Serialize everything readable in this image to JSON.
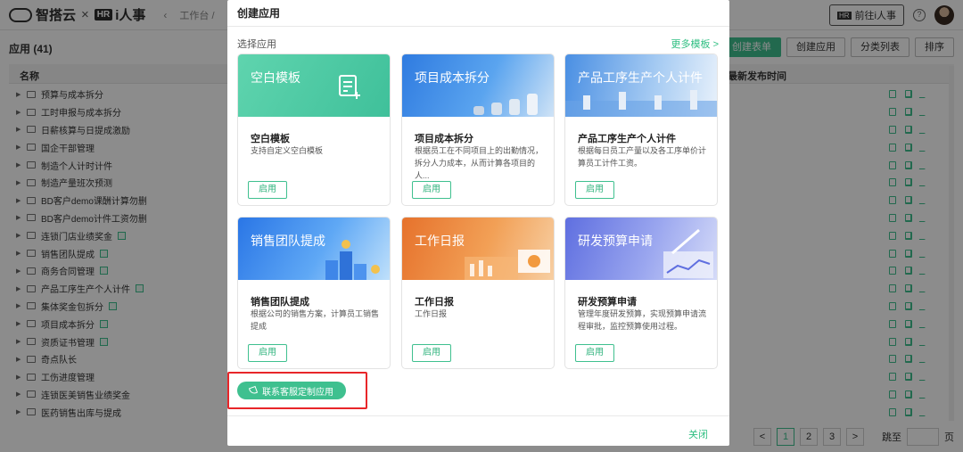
{
  "topbar": {
    "brand_name": "智搭云",
    "separator": "×",
    "hr_logo": "HR",
    "hr_product": "i人事",
    "back_icon": "‹",
    "breadcrumb": "工作台 /",
    "goto_hr_label": "前往i人事",
    "help_icon": "?"
  },
  "page": {
    "title": "应用 (41)",
    "buttons": {
      "create_form": "创建表单",
      "create_app": "创建应用",
      "category_list": "分类列表",
      "sort": "排序"
    },
    "columns": {
      "name": "名称",
      "latest_publish": "最新发布时间"
    },
    "rows": [
      {
        "name": "预算与成本拆分",
        "tag": false
      },
      {
        "name": "工时申报与成本拆分",
        "tag": false
      },
      {
        "name": "日薪核算与日提成激励",
        "tag": false
      },
      {
        "name": "国企干部管理",
        "tag": false
      },
      {
        "name": "制造个人计时计件",
        "tag": false
      },
      {
        "name": "制造产量班次预测",
        "tag": false
      },
      {
        "name": "BD客户demo课酬计算勿删",
        "tag": false
      },
      {
        "name": "BD客户demo计件工资勿删",
        "tag": false
      },
      {
        "name": "连锁门店业绩奖金",
        "tag": true
      },
      {
        "name": "销售团队提成",
        "tag": true
      },
      {
        "name": "商务合同管理",
        "tag": true
      },
      {
        "name": "产品工序生产个人计件",
        "tag": true
      },
      {
        "name": "集体奖金包拆分",
        "tag": true
      },
      {
        "name": "项目成本拆分",
        "tag": true
      },
      {
        "name": "资质证书管理",
        "tag": true
      },
      {
        "name": "奇点队长",
        "tag": false
      },
      {
        "name": "工伤进度管理",
        "tag": false
      },
      {
        "name": "连锁医美销售业绩奖金",
        "tag": false
      },
      {
        "name": "医药销售出库与提成",
        "tag": false
      }
    ],
    "pager": {
      "prev": "<",
      "pages": [
        "1",
        "2",
        "3"
      ],
      "current": "1",
      "next": ">",
      "jump_label": "跳至",
      "page_suffix": "页"
    }
  },
  "modal": {
    "title": "创建应用",
    "section_label": "选择应用",
    "more_templates": "更多模板 >",
    "use_label": "启用",
    "cards": [
      {
        "banner": "空白模板",
        "name": "空白模板",
        "desc": "支持自定义空白模板"
      },
      {
        "banner": "项目成本拆分",
        "name": "项目成本拆分",
        "desc": "根据员工在不同项目上的出勤情况，拆分人力成本，从而计算各项目的人..."
      },
      {
        "banner": "产品工序生产个人计件",
        "name": "产品工序生产个人计件",
        "desc": "根据每日员工产量以及各工序单价计算员工计件工资。"
      },
      {
        "banner": "销售团队提成",
        "name": "销售团队提成",
        "desc": "根据公司的销售方案，计算员工销售提成"
      },
      {
        "banner": "工作日报",
        "name": "工作日报",
        "desc": "工作日报"
      },
      {
        "banner": "研发预算申请",
        "name": "研发预算申请",
        "desc": "管理年度研发预算，实现预算申请流程审批，监控预算使用过程。"
      }
    ],
    "contact_label": "联系客服定制应用",
    "close_label": "关闭"
  },
  "colors": {
    "accent": "#3fc08f",
    "highlight_border": "#e8262a"
  }
}
